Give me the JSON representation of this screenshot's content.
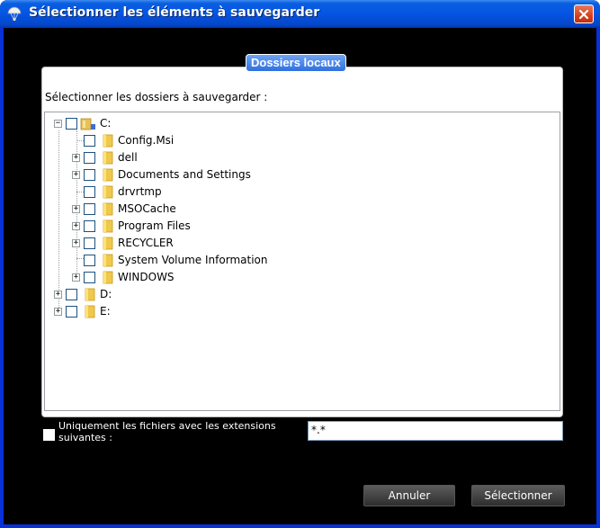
{
  "window": {
    "title": "Sélectionner les éléments à sauvegarder",
    "icons": {
      "app": "parachute-icon",
      "close": "close-icon"
    }
  },
  "group": {
    "title": "Dossiers locaux",
    "prompt": "Sélectionner les dossiers à sauvegarder :"
  },
  "tree": {
    "nodes": [
      {
        "label": "C:",
        "expander": "minus",
        "icon": "drive-icon",
        "checked": false
      },
      {
        "label": "Config.Msi",
        "expander": "none",
        "icon": "folder-icon",
        "checked": false
      },
      {
        "label": "dell",
        "expander": "plus",
        "icon": "folder-icon",
        "checked": false
      },
      {
        "label": "Documents and Settings",
        "expander": "plus",
        "icon": "folder-icon",
        "checked": false
      },
      {
        "label": "drvrtmp",
        "expander": "none",
        "icon": "folder-icon",
        "checked": false
      },
      {
        "label": "MSOCache",
        "expander": "plus",
        "icon": "folder-icon",
        "checked": false
      },
      {
        "label": "Program Files",
        "expander": "plus",
        "icon": "folder-icon",
        "checked": false
      },
      {
        "label": "RECYCLER",
        "expander": "plus",
        "icon": "folder-icon",
        "checked": false
      },
      {
        "label": "System Volume Information",
        "expander": "none",
        "icon": "folder-icon",
        "checked": false
      },
      {
        "label": "WINDOWS",
        "expander": "plus",
        "icon": "folder-icon",
        "checked": false
      },
      {
        "label": "D:",
        "expander": "plus",
        "icon": "drive-icon",
        "checked": false
      },
      {
        "label": "E:",
        "expander": "plus",
        "icon": "drive-icon",
        "checked": false
      }
    ]
  },
  "filter": {
    "label": "Uniquement les fichiers avec les extensions suivantes :",
    "checked": false,
    "value": "*.*"
  },
  "buttons": {
    "cancel": "Annuler",
    "select": "Sélectionner"
  },
  "colors": {
    "titlebar": "#0554e3",
    "client_background": "#000000",
    "close_button": "#d7411d"
  }
}
